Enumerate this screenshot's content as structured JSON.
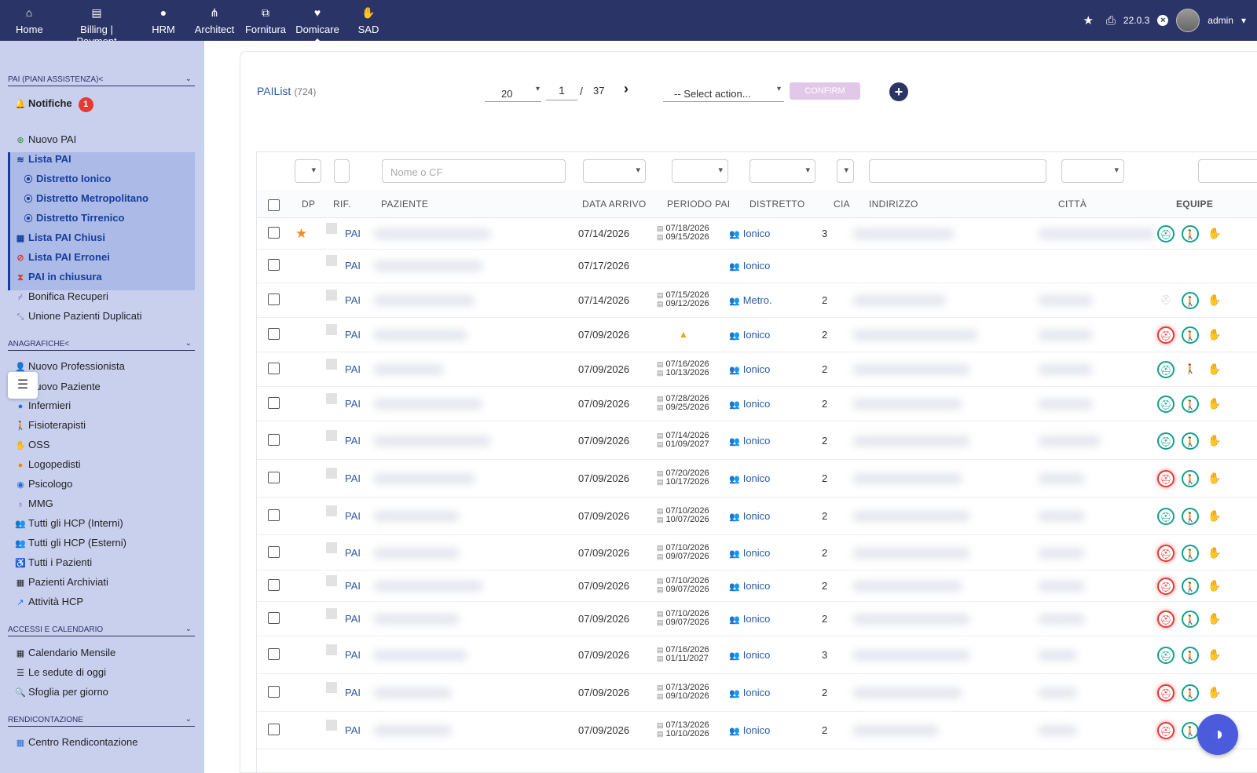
{
  "topnav": {
    "items": [
      {
        "label": "Home",
        "icon": "home-icon"
      },
      {
        "label": "Billing | Payment",
        "icon": "file-invoice-icon"
      },
      {
        "label": "HRM",
        "icon": "user-tie-icon"
      },
      {
        "label": "Architect",
        "icon": "sitemap-icon"
      },
      {
        "label": "Fornitura",
        "icon": "boxes-icon"
      },
      {
        "label": "Domicare",
        "icon": "heart-pulse-icon"
      },
      {
        "label": "SAD",
        "icon": "hand-holding-icon"
      }
    ],
    "active": "Domicare",
    "version": "22.0.3",
    "username": "admin"
  },
  "sidebar": {
    "sections": [
      {
        "title": "PAI (PIANI ASSISTENZA)<"
      },
      {
        "title": "ANAGRAFICHE<"
      },
      {
        "title": "ACCESSI E CALENDARIO"
      },
      {
        "title": "RENDICONTAZIONE"
      }
    ],
    "notifiche_label": "Notifiche",
    "notifiche_count": "1",
    "pai_items": [
      {
        "label": "Nuovo PAI",
        "icon": "plus-circle-icon"
      },
      {
        "label": "Lista PAI",
        "icon": "layers-icon"
      },
      {
        "label": "Distretto Ionico",
        "icon": "map-marker-icon"
      },
      {
        "label": "Distretto Metropolitano",
        "icon": "map-marker-icon"
      },
      {
        "label": "Distretto Tirrenico",
        "icon": "map-marker-icon"
      },
      {
        "label": "Lista PAI Chiusi",
        "icon": "archive-icon"
      },
      {
        "label": "Lista PAI Erronei",
        "icon": "ban-icon"
      },
      {
        "label": "PAI in chiusura",
        "icon": "hourglass-icon"
      },
      {
        "label": "Bonifica Recuperi",
        "icon": "broom-icon"
      },
      {
        "label": "Unione Pazienti Duplicati",
        "icon": "compress-icon"
      }
    ],
    "anagrafiche_items": [
      {
        "label": "Nuovo Professionista",
        "icon": "user-plus-icon"
      },
      {
        "label": "Nuovo Paziente",
        "icon": "user-plus-icon"
      },
      {
        "label": "Infermieri",
        "icon": "nurse-icon"
      },
      {
        "label": "Fisioterapisti",
        "icon": "walking-icon"
      },
      {
        "label": "OSS",
        "icon": "hands-icon"
      },
      {
        "label": "Logopedisti",
        "icon": "comment-icon"
      },
      {
        "label": "Psicologo",
        "icon": "brain-icon"
      },
      {
        "label": "MMG",
        "icon": "stethoscope-icon"
      },
      {
        "label": "Tutti gli HCP (Interni)",
        "icon": "users-icon"
      },
      {
        "label": "Tutti gli HCP (Esterni)",
        "icon": "users-slash-icon"
      },
      {
        "label": "Tutti i Pazienti",
        "icon": "wheelchair-icon"
      },
      {
        "label": "Pazienti Archiviati",
        "icon": "archive-icon"
      },
      {
        "label": "Attività HCP",
        "icon": "chart-line-icon"
      }
    ],
    "accessi_items": [
      {
        "label": "Calendario Mensile",
        "icon": "calendar-icon"
      },
      {
        "label": "Le sedute di oggi",
        "icon": "list-icon"
      },
      {
        "label": "Sfoglia per giorno",
        "icon": "search-icon"
      }
    ],
    "rendicontazione_items": [
      {
        "label": "Centro Rendicontazione",
        "icon": "calendar-check-icon"
      }
    ]
  },
  "toolbar": {
    "list_title": "PAIList",
    "list_count": "(724)",
    "page_size": "20",
    "current_page": "1",
    "page_separator": "/",
    "total_pages": "37",
    "action_placeholder": "-- Select action...",
    "confirm_label": "CONFIRM"
  },
  "filters": {
    "search_placeholder": "Nome o CF"
  },
  "table": {
    "headers": {
      "dp": "DP",
      "rif": "RIF.",
      "paziente": "PAZIENTE",
      "data_arrivo": "DATA ARRIVO",
      "periodo_pai": "PERIODO PAI",
      "distretto": "DISTRETTO",
      "cia": "CIA",
      "indirizzo": "INDIRIZZO",
      "citta": "CITTÀ",
      "equipe": "EQUIPE"
    },
    "rows": [
      {
        "rif": "PAI",
        "starred": true,
        "data_arrivo": "07/14/2026",
        "periodo_start": "07/18/2026",
        "periodo_end": "09/15/2026",
        "warning": false,
        "distretto": "Ionico",
        "cia": "3",
        "nurse": "ok",
        "physio": "ok",
        "extra": "dim"
      },
      {
        "rif": "PAI",
        "starred": false,
        "data_arrivo": "07/17/2026",
        "periodo_start": "",
        "periodo_end": "",
        "warning": false,
        "distretto": "Ionico",
        "cia": "",
        "nurse": "none",
        "physio": "none",
        "extra": "none"
      },
      {
        "rif": "PAI",
        "starred": false,
        "data_arrivo": "07/14/2026",
        "periodo_start": "07/15/2026",
        "periodo_end": "09/12/2026",
        "warning": false,
        "distretto": "Metro.",
        "cia": "2",
        "nurse": "dim",
        "physio": "ok",
        "extra": "dim"
      },
      {
        "rif": "PAI",
        "starred": false,
        "data_arrivo": "07/09/2026",
        "periodo_start": "",
        "periodo_end": "",
        "warning": true,
        "distretto": "Ionico",
        "cia": "2",
        "nurse": "bad",
        "physio": "ok",
        "extra": "dim"
      },
      {
        "rif": "PAI",
        "starred": false,
        "data_arrivo": "07/09/2026",
        "periodo_start": "07/16/2026",
        "periodo_end": "10/13/2026",
        "warning": false,
        "distretto": "Ionico",
        "cia": "2",
        "nurse": "ok",
        "physio": "dim",
        "extra": "dim"
      },
      {
        "rif": "PAI",
        "starred": false,
        "data_arrivo": "07/09/2026",
        "periodo_start": "07/28/2026",
        "periodo_end": "09/25/2026",
        "warning": false,
        "distretto": "Ionico",
        "cia": "2",
        "nurse": "ok",
        "physio": "ok",
        "extra": "dim"
      },
      {
        "rif": "PAI",
        "starred": false,
        "data_arrivo": "07/09/2026",
        "periodo_start": "07/14/2026",
        "periodo_end": "01/09/2027",
        "warning": false,
        "distretto": "Ionico",
        "cia": "2",
        "nurse": "ok",
        "physio": "ok",
        "extra": "dim"
      },
      {
        "rif": "PAI",
        "starred": false,
        "data_arrivo": "07/09/2026",
        "periodo_start": "07/20/2026",
        "periodo_end": "10/17/2026",
        "warning": false,
        "distretto": "Ionico",
        "cia": "2",
        "nurse": "bad",
        "physio": "ok",
        "extra": "dim"
      },
      {
        "rif": "PAI",
        "starred": false,
        "data_arrivo": "07/09/2026",
        "periodo_start": "07/10/2026",
        "periodo_end": "10/07/2026",
        "warning": false,
        "distretto": "Ionico",
        "cia": "2",
        "nurse": "ok",
        "physio": "ok",
        "extra": "dim"
      },
      {
        "rif": "PAI",
        "starred": false,
        "data_arrivo": "07/09/2026",
        "periodo_start": "07/10/2026",
        "periodo_end": "09/07/2026",
        "warning": false,
        "distretto": "Ionico",
        "cia": "2",
        "nurse": "bad",
        "physio": "ok",
        "extra": "dim"
      },
      {
        "rif": "PAI",
        "starred": false,
        "data_arrivo": "07/09/2026",
        "periodo_start": "07/10/2026",
        "periodo_end": "09/07/2026",
        "warning": false,
        "distretto": "Ionico",
        "cia": "2",
        "nurse": "bad",
        "physio": "ok",
        "extra": "dim"
      },
      {
        "rif": "PAI",
        "starred": false,
        "data_arrivo": "07/09/2026",
        "periodo_start": "07/10/2026",
        "periodo_end": "09/07/2026",
        "warning": false,
        "distretto": "Ionico",
        "cia": "2",
        "nurse": "bad",
        "physio": "ok",
        "extra": "dim"
      },
      {
        "rif": "PAI",
        "starred": false,
        "data_arrivo": "07/09/2026",
        "periodo_start": "07/16/2026",
        "periodo_end": "01/11/2027",
        "warning": false,
        "distretto": "Ionico",
        "cia": "3",
        "nurse": "ok",
        "physio": "ok",
        "extra": "dim"
      },
      {
        "rif": "PAI",
        "starred": false,
        "data_arrivo": "07/09/2026",
        "periodo_start": "07/13/2026",
        "periodo_end": "09/10/2026",
        "warning": false,
        "distretto": "Ionico",
        "cia": "2",
        "nurse": "bad",
        "physio": "ok",
        "extra": "dim"
      },
      {
        "rif": "PAI",
        "starred": false,
        "data_arrivo": "07/09/2026",
        "periodo_start": "07/13/2026",
        "periodo_end": "10/10/2026",
        "warning": false,
        "distretto": "Ionico",
        "cia": "2",
        "nurse": "bad",
        "physio": "ok",
        "extra": "dim"
      }
    ]
  },
  "colors": {
    "topbar": "#2b3467",
    "sidebar": "#c9d0ee",
    "link": "#2c5aa0",
    "equipe_ok": "#12a08a",
    "equipe_missing": "#e53935"
  }
}
